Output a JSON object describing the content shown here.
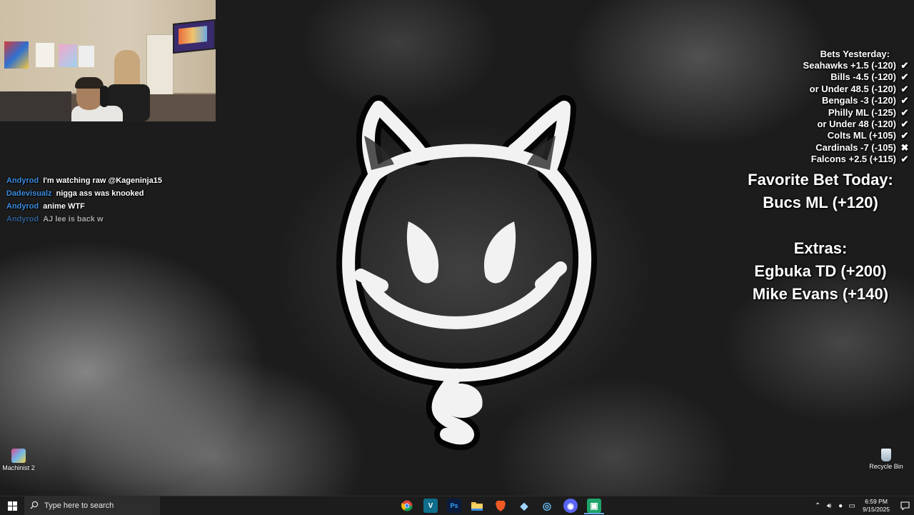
{
  "chat": [
    {
      "user": "Andyrod",
      "message": "I'm watching raw @Kageninja15"
    },
    {
      "user": "Dadevisualz",
      "message": "nigga ass was knooked"
    },
    {
      "user": "Andyrod",
      "message": "anime WTF"
    },
    {
      "user": "Andyrod",
      "message": "AJ lee is back w"
    }
  ],
  "bets": {
    "title": "Bets Yesterday:",
    "rows": [
      {
        "text": "Seahawks +1.5 (-120)",
        "mark": "✔"
      },
      {
        "text": "Bills -4.5 (-120)",
        "mark": "✔"
      },
      {
        "text": "or Under 48.5 (-120)",
        "mark": "✔"
      },
      {
        "text": "Bengals -3 (-120)",
        "mark": "✔"
      },
      {
        "text": "Philly ML (-125)",
        "mark": "✔"
      },
      {
        "text": "or Under 48 (-120)",
        "mark": "✔"
      },
      {
        "text": "Colts ML (+105)",
        "mark": "✔"
      },
      {
        "text": "Cardinals -7 (-105)",
        "mark": "✖"
      },
      {
        "text": "Falcons +2.5 (+115)",
        "mark": "✔"
      }
    ]
  },
  "featured": {
    "title": "Favorite Bet Today:",
    "bet": "Bucs ML (+120)",
    "extras_title": "Extras:",
    "extras": [
      "Egbuka TD (+200)",
      "Mike Evans (+140)"
    ]
  },
  "desktop_icons": {
    "left_label": "Machinist 2",
    "right_label": "Recycle Bin"
  },
  "taskbar": {
    "search_placeholder": "Type here to search",
    "apps": [
      {
        "name": "chrome-icon",
        "glyph": "",
        "color": "#e8453c"
      },
      {
        "name": "vs-icon",
        "glyph": "V",
        "color": "#0f6e8c"
      },
      {
        "name": "photoshop-icon",
        "glyph": "Ps",
        "color": "#0a1b3c"
      },
      {
        "name": "file-explorer-icon",
        "glyph": "",
        "color": "#f0c34a"
      },
      {
        "name": "brave-icon",
        "glyph": "",
        "color": "#f05a24"
      },
      {
        "name": "game-launcher-icon",
        "glyph": "◆",
        "color": "#3d4a5a"
      },
      {
        "name": "steam-icon",
        "glyph": "◎",
        "color": "#1b2838"
      },
      {
        "name": "discord-icon",
        "glyph": "◉",
        "color": "#5865f2"
      },
      {
        "name": "obs-style-icon",
        "glyph": "▣",
        "color": "#1fa36b"
      }
    ],
    "time": "6:59 PM",
    "date": "9/15/2025"
  }
}
